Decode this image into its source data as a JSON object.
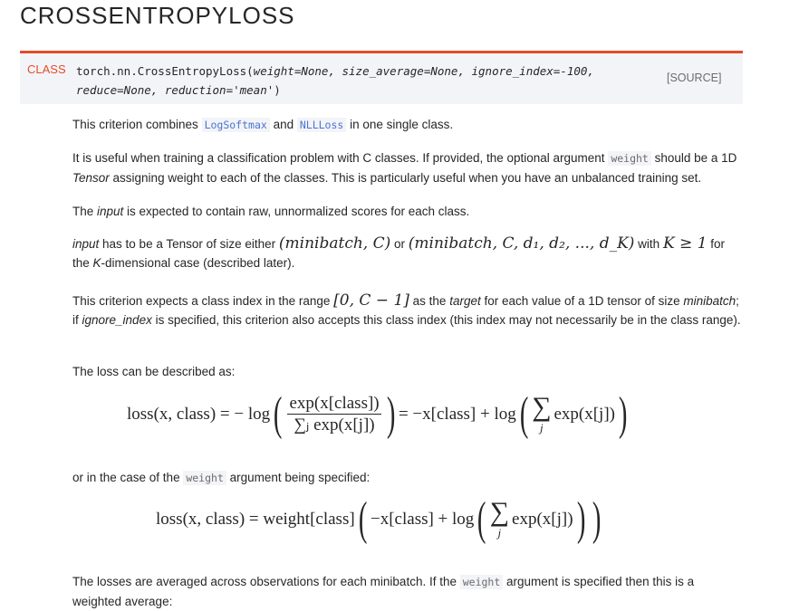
{
  "title": "CROSSENTROPYLOSS",
  "signature": {
    "label": "CLASS",
    "name": "torch.nn.CrossEntropyLoss(",
    "args1": "weight=None, size_average=None, ignore_index=-100,",
    "args2": "reduce=None, reduction='mean'",
    "close": ")",
    "source": "[SOURCE]"
  },
  "p1": {
    "a": "This criterion combines ",
    "link1": "LogSoftmax",
    "b": " and ",
    "link2": "NLLLoss",
    "c": " in one single class."
  },
  "p2": {
    "a": "It is useful when training a classification problem with C classes. If provided, the optional argument ",
    "code": "weight",
    "b": " should be a 1D ",
    "em": "Tensor",
    "c": " assigning weight to each of the classes. This is particularly useful when you have an unbalanced training set."
  },
  "p3": {
    "a": "The ",
    "em": "input",
    "b": " is expected to contain raw, unnormalized scores for each class."
  },
  "p4": {
    "em": "input",
    "a": " has to be a Tensor of size either ",
    "m1": "(minibatch, C)",
    "b": " or ",
    "m2": "(minibatch, C, d₁, d₂, ..., d_K)",
    "c": " with ",
    "m3": "K ≥ 1",
    "d": " for the ",
    "em2": "K",
    "e": "-dimensional case (described later)."
  },
  "p5": {
    "a": "This criterion expects a class index in the range ",
    "m1": "[0, C − 1]",
    "b": " as the ",
    "em1": "target",
    "c": " for each value of a 1D tensor of size ",
    "em2": "minibatch",
    "d": "; if ",
    "em3": "ignore_index",
    "e": " is specified, this criterion also accepts this class index (this index may not necessarily be in the class range)."
  },
  "p6": "The loss can be described as:",
  "eq1": {
    "lhs": "loss(x, class) = − log",
    "num": "exp(x[class])",
    "den": "∑ⱼ exp(x[j])",
    "mid": "= −x[class] + log",
    "sum": "∑",
    "j": "j",
    "tail": "exp(x[j])"
  },
  "p7": {
    "a": "or in the case of the ",
    "code": "weight",
    "b": " argument being specified:"
  },
  "eq2": {
    "lhs": "loss(x, class) = weight[class]",
    "mid": "−x[class] + log",
    "sum": "∑",
    "j": "j",
    "tail": "exp(x[j])"
  },
  "p8": {
    "a": "The losses are averaged across observations for each minibatch. If the ",
    "code": "weight",
    "b": " argument is specified then this is a weighted average:"
  }
}
